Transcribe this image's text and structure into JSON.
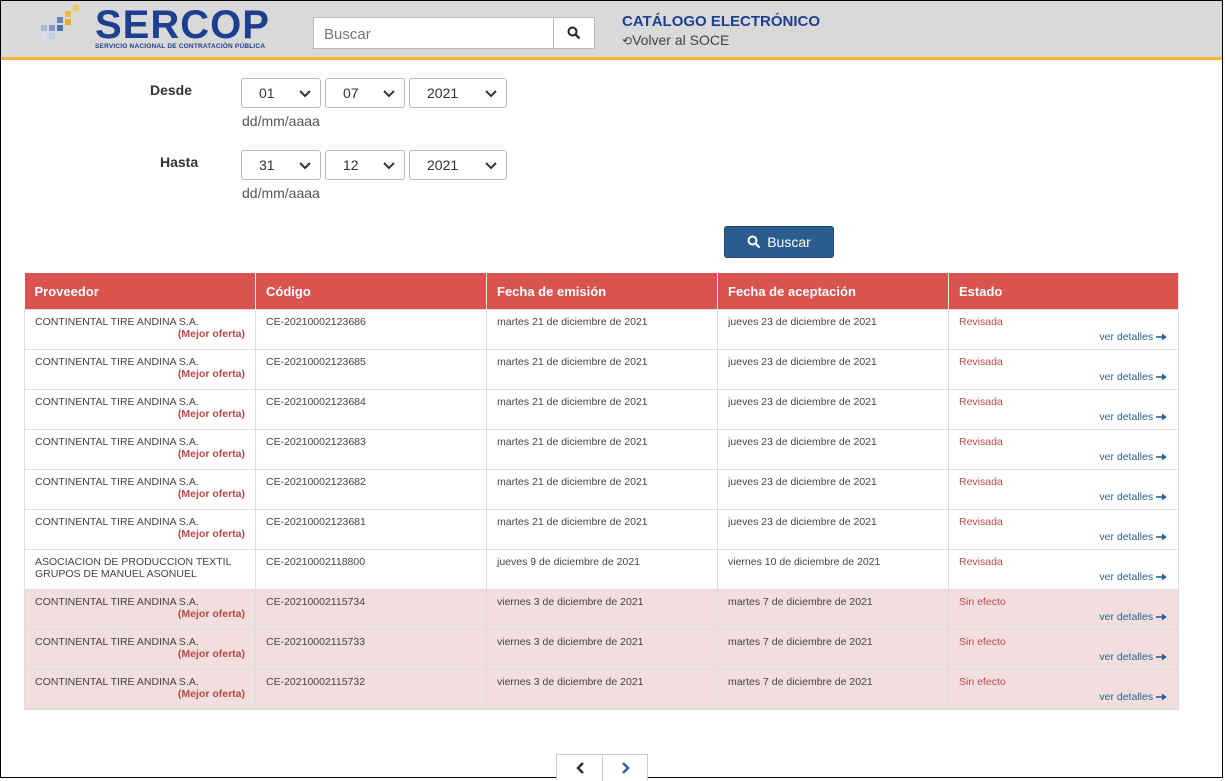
{
  "header": {
    "logo_text": "SERCOP",
    "logo_subtitle": "SERVICIO NACIONAL DE CONTRATACIÓN PÚBLICA",
    "search_placeholder": "Buscar",
    "catalog_title": "CATÁLOGO ELECTRÓNICO",
    "back_link": "Volver al SOCE"
  },
  "filters": {
    "desde": {
      "label": "Desde",
      "day": "01",
      "month": "07",
      "year": "2021",
      "hint": "dd/mm/aaaa"
    },
    "hasta": {
      "label": "Hasta",
      "day": "31",
      "month": "12",
      "year": "2021",
      "hint": "dd/mm/aaaa"
    },
    "search_button": "Buscar"
  },
  "table": {
    "columns": [
      "Proveedor",
      "Código",
      "Fecha de emisión",
      "Fecha de aceptación",
      "Estado"
    ],
    "detail_link": "ver detalles",
    "rows": [
      {
        "proveedor": "CONTINENTAL TIRE ANDINA S.A.",
        "mejor_oferta": "(Mejor oferta)",
        "codigo": "CE-20210002123686",
        "emision": "martes 21 de diciembre de 2021",
        "aceptacion": "jueves 23 de diciembre de 2021",
        "estado": "Revisada",
        "highlight": false
      },
      {
        "proveedor": "CONTINENTAL TIRE ANDINA S.A.",
        "mejor_oferta": "(Mejor oferta)",
        "codigo": "CE-20210002123685",
        "emision": "martes 21 de diciembre de 2021",
        "aceptacion": "jueves 23 de diciembre de 2021",
        "estado": "Revisada",
        "highlight": false
      },
      {
        "proveedor": "CONTINENTAL TIRE ANDINA S.A.",
        "mejor_oferta": "(Mejor oferta)",
        "codigo": "CE-20210002123684",
        "emision": "martes 21 de diciembre de 2021",
        "aceptacion": "jueves 23 de diciembre de 2021",
        "estado": "Revisada",
        "highlight": false
      },
      {
        "proveedor": "CONTINENTAL TIRE ANDINA S.A.",
        "mejor_oferta": "(Mejor oferta)",
        "codigo": "CE-20210002123683",
        "emision": "martes 21 de diciembre de 2021",
        "aceptacion": "jueves 23 de diciembre de 2021",
        "estado": "Revisada",
        "highlight": false
      },
      {
        "proveedor": "CONTINENTAL TIRE ANDINA S.A.",
        "mejor_oferta": "(Mejor oferta)",
        "codigo": "CE-20210002123682",
        "emision": "martes 21 de diciembre de 2021",
        "aceptacion": "jueves 23 de diciembre de 2021",
        "estado": "Revisada",
        "highlight": false
      },
      {
        "proveedor": "CONTINENTAL TIRE ANDINA S.A.",
        "mejor_oferta": "(Mejor oferta)",
        "codigo": "CE-20210002123681",
        "emision": "martes 21 de diciembre de 2021",
        "aceptacion": "jueves 23 de diciembre de 2021",
        "estado": "Revisada",
        "highlight": false
      },
      {
        "proveedor": "ASOCIACION DE PRODUCCION TEXTIL GRUPOS DE MANUEL ASONUEL",
        "mejor_oferta": "",
        "codigo": "CE-20210002118800",
        "emision": "jueves 9 de diciembre de 2021",
        "aceptacion": "viernes 10 de diciembre de 2021",
        "estado": "Revisada",
        "highlight": false
      },
      {
        "proveedor": "CONTINENTAL TIRE ANDINA S.A.",
        "mejor_oferta": "(Mejor oferta)",
        "codigo": "CE-20210002115734",
        "emision": "viernes 3 de diciembre de 2021",
        "aceptacion": "martes 7 de diciembre de 2021",
        "estado": "Sin efecto",
        "highlight": true
      },
      {
        "proveedor": "CONTINENTAL TIRE ANDINA S.A.",
        "mejor_oferta": "(Mejor oferta)",
        "codigo": "CE-20210002115733",
        "emision": "viernes 3 de diciembre de 2021",
        "aceptacion": "martes 7 de diciembre de 2021",
        "estado": "Sin efecto",
        "highlight": true
      },
      {
        "proveedor": "CONTINENTAL TIRE ANDINA S.A.",
        "mejor_oferta": "(Mejor oferta)",
        "codigo": "CE-20210002115732",
        "emision": "viernes 3 de diciembre de 2021",
        "aceptacion": "martes 7 de diciembre de 2021",
        "estado": "Sin efecto",
        "highlight": true
      }
    ]
  },
  "pagination": {
    "prev_icon": "chevron-left-icon",
    "next_icon": "chevron-right-icon"
  },
  "colors": {
    "brand_blue": "#1d3f8f",
    "header_red": "#d9534f",
    "accent_yellow": "#f2b63c",
    "button_blue": "#2c5d8f",
    "inactive_row": "#f2dede"
  }
}
